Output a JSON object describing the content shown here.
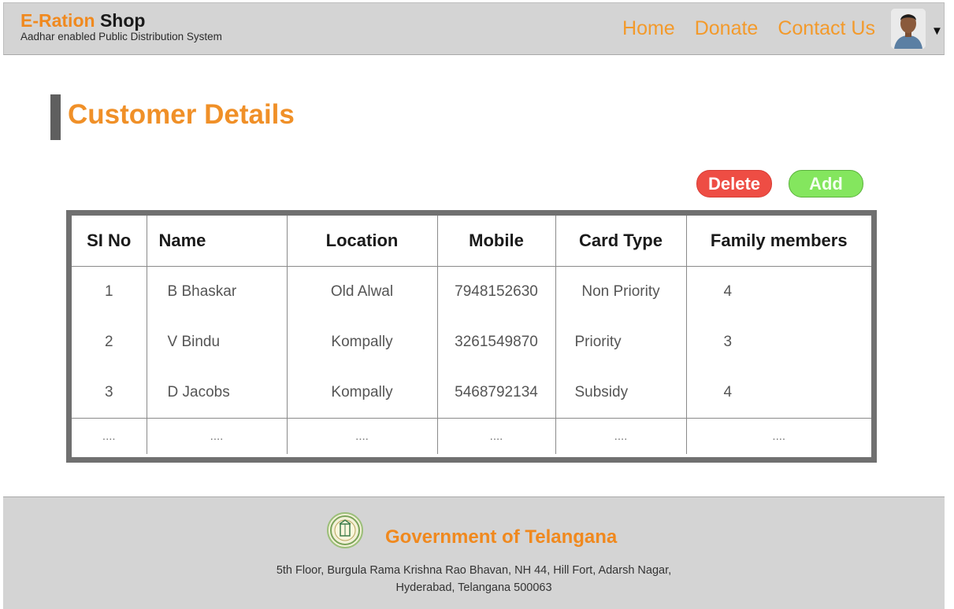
{
  "header": {
    "brand_e": "E-Ration",
    "brand_shop": "Shop",
    "tagline": "Aadhar enabled Public Distribution System",
    "nav": [
      "Home",
      "Donate",
      "Contact Us"
    ]
  },
  "page": {
    "title": "Customer Details"
  },
  "actions": {
    "delete_label": "Delete",
    "add_label": "Add"
  },
  "table": {
    "headers": [
      "SI No",
      "Name",
      "Location",
      "Mobile",
      "Card Type",
      "Family members"
    ],
    "rows": [
      [
        "1",
        "B Bhaskar",
        "Old Alwal",
        "7948152630",
        "Non Priority",
        "4"
      ],
      [
        "2",
        "V Bindu",
        "Kompally",
        "3261549870",
        "Priority",
        "3"
      ],
      [
        "3",
        "D Jacobs",
        "Kompally",
        "5468792134",
        "Subsidy",
        "4"
      ]
    ],
    "placeholder": "...."
  },
  "footer": {
    "org": "Government of Telangana",
    "address_line1": "5th Floor, Burgula Rama Krishna Rao Bhavan, NH 44, Hill Fort, Adarsh Nagar,",
    "address_line2": "Hyderabad, Telangana 500063"
  },
  "icons": {
    "avatar": "user-avatar",
    "caret": "caret-down-icon",
    "emblem": "state-emblem"
  },
  "colors": {
    "accent": "#f0891e",
    "delete": "#ee4d44",
    "add": "#84e65e",
    "header_bg": "#d4d4d4"
  }
}
